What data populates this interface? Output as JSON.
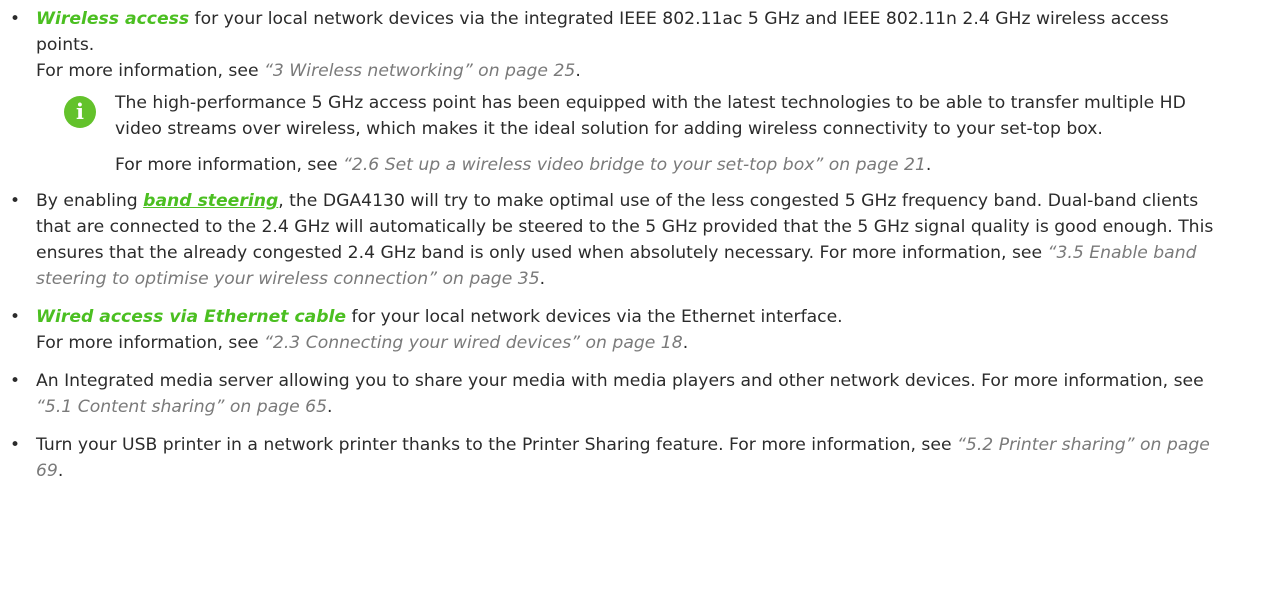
{
  "bullets": [
    {
      "keyword": "Wireless access",
      "text": " for your local network devices via the integrated IEEE 802.11ac 5 GHz and IEEE 802.11n 2.4 GHz wireless access points.",
      "more_prefix": "For more information, see ",
      "ref": "“3 Wireless networking” on page 25",
      "more_suffix": ".",
      "info": {
        "icon": "info-icon",
        "text": "The high-performance 5 GHz access point has been equipped with the latest technologies to be able to transfer multiple HD video streams over wireless, which makes it the ideal solution for adding wireless connectivity to your set-top box.",
        "more_prefix": "For more information, see ",
        "ref": "“2.6 Set up a wireless video bridge to your set-top box” on page 21",
        "more_suffix": "."
      }
    },
    {
      "prefix": "By enabling ",
      "keyword": "band steering",
      "text": ", the DGA4130 will try to make optimal use of the less congested 5 GHz frequency band. Dual-band clients that are connected to the 2.4 GHz will automatically be steered to the 5 GHz provided that the 5 GHz signal quality is good enough. This ensures that the already congested 2.4 GHz band is only used when absolutely necessary. For more information, see ",
      "ref": "“3.5 Enable band steering to optimise your wireless connection” on page 35",
      "suffix": "."
    },
    {
      "keyword": "Wired access via Ethernet cable",
      "text": " for your local network devices via the Ethernet interface.",
      "more_prefix": "For more information, see ",
      "ref": "“2.3 Connecting your wired devices” on page 18",
      "more_suffix": "."
    },
    {
      "text": "An Integrated media server allowing you to share your media with media players and other network devices. For more information, see ",
      "ref": "“5.1 Content sharing” on page 65",
      "suffix": "."
    },
    {
      "text": "Turn your USB printer in a network printer thanks to the Printer Sharing feature. For more information, see ",
      "ref": "“5.2 Printer sharing” on page 69",
      "suffix": "."
    }
  ],
  "bullet_symbol": "•",
  "info_icon_glyph": "i",
  "colors": {
    "keyword": "#4bbf21",
    "reference": "#7a7a7a",
    "text": "#2b2b2b",
    "info_icon": "#63c22b"
  }
}
